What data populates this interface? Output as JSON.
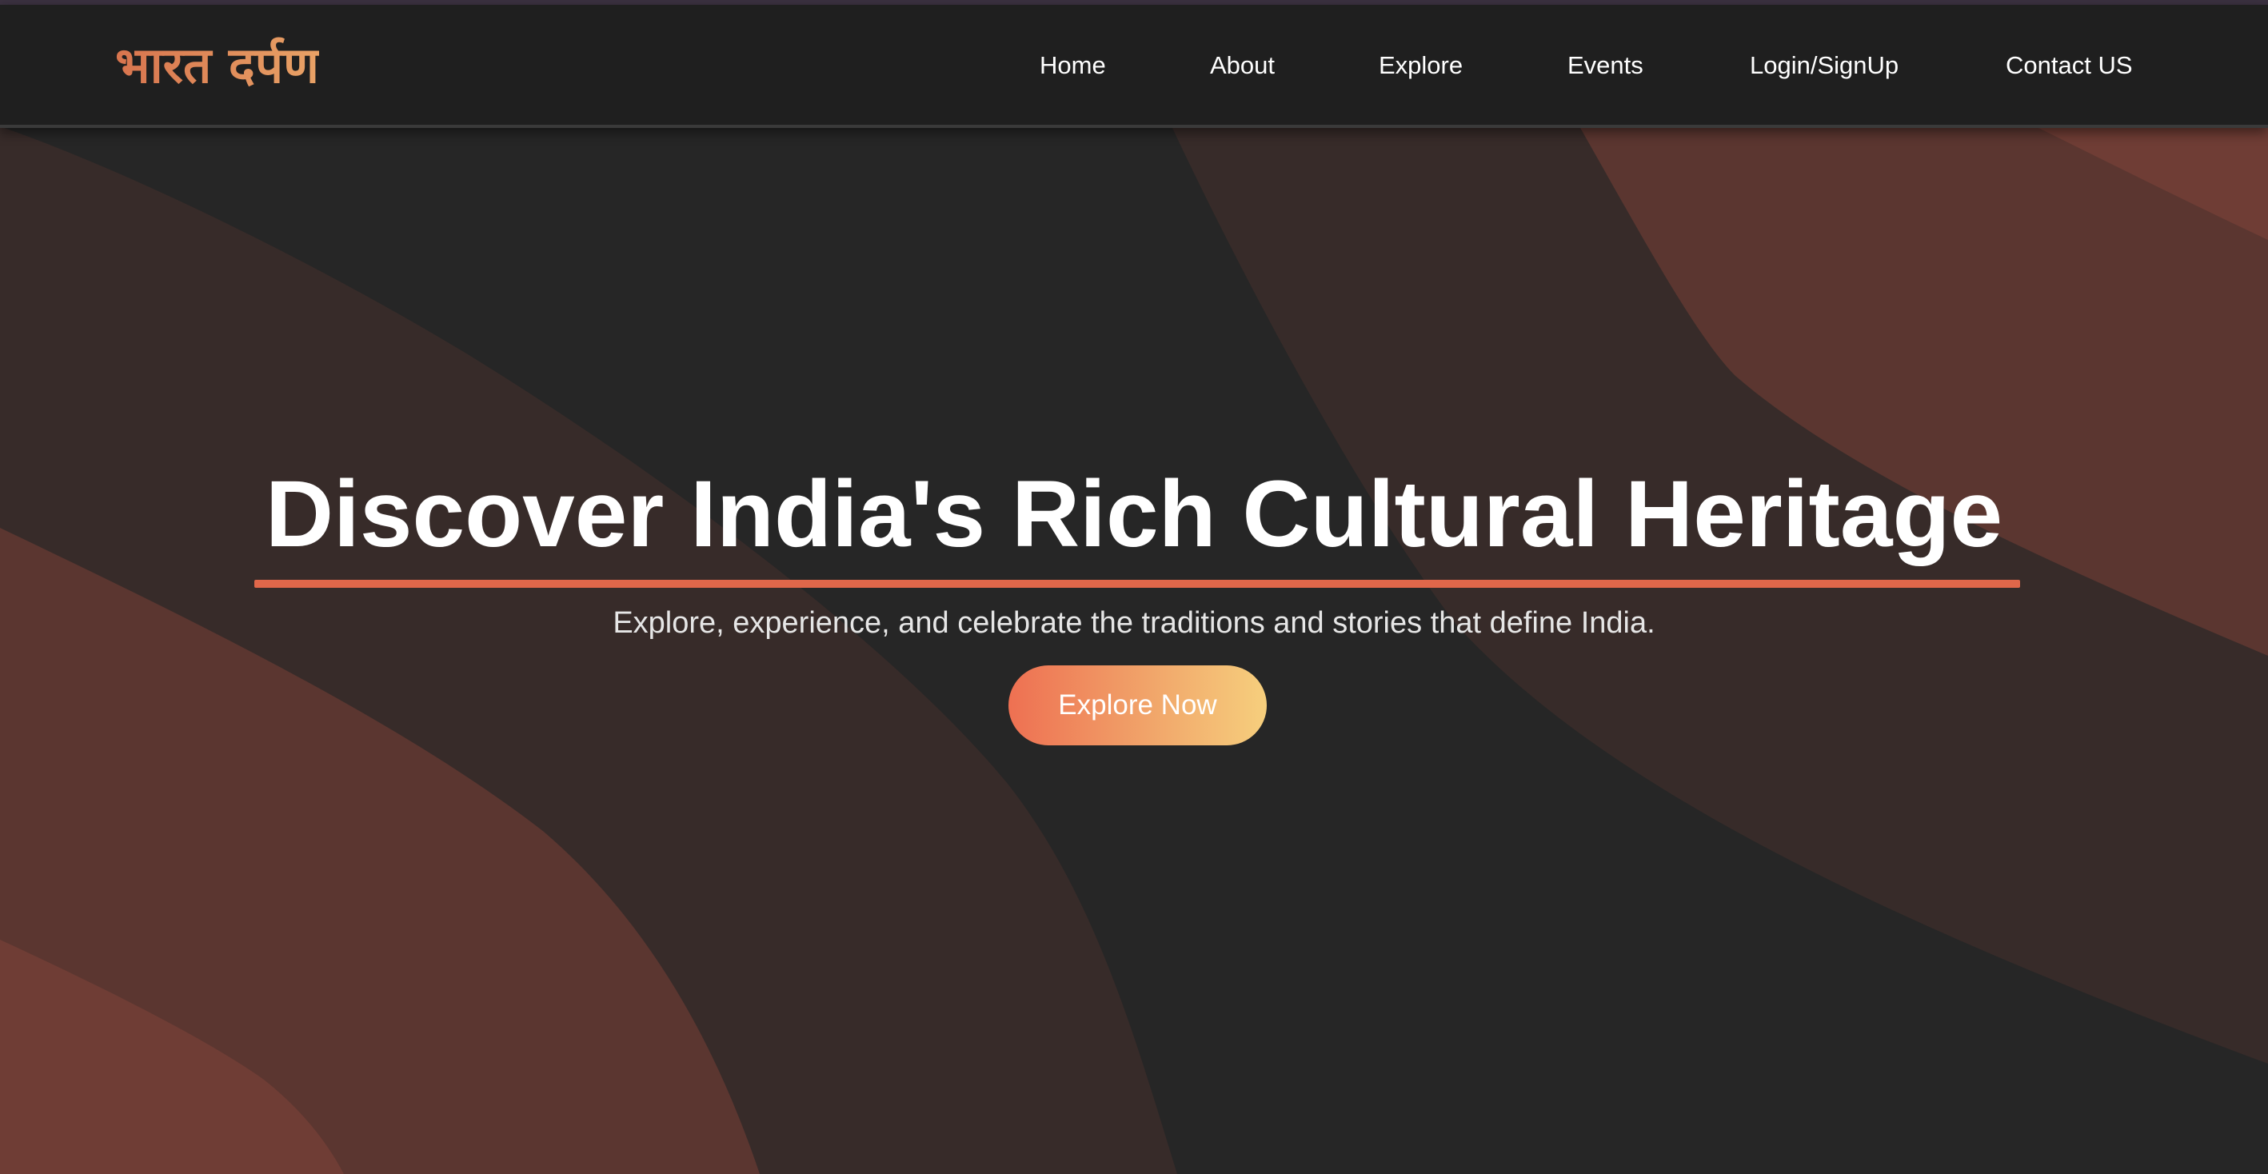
{
  "header": {
    "logo_text": "भारत दर्पण",
    "nav": [
      {
        "label": "Home"
      },
      {
        "label": "About"
      },
      {
        "label": "Explore"
      },
      {
        "label": "Events"
      },
      {
        "label": "Login/SignUp"
      },
      {
        "label": "Contact US"
      }
    ]
  },
  "hero": {
    "title": "Discover India's Rich Cultural Heritage",
    "subtitle": "Explore, experience, and celebrate the traditions and stories that define India.",
    "cta_label": "Explore Now"
  },
  "colors": {
    "background": "#262626",
    "navbar": "#1f1f1f",
    "accent": "#e0674a",
    "cta_start": "#ee7052",
    "cta_end": "#f6cf7d",
    "wave_dark": "#372b29",
    "wave_mid": "#5b3630",
    "wave_light": "#6f3d35"
  }
}
